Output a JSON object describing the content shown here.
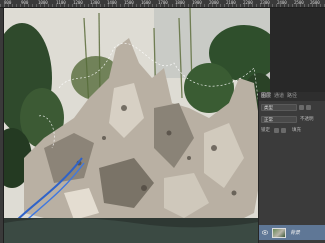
{
  "ruler": {
    "labels": [
      "800",
      "900",
      "1000",
      "1100",
      "1200",
      "1300",
      "1400",
      "1500",
      "1600",
      "1700",
      "1800",
      "1900",
      "2000",
      "2100",
      "2200",
      "2300",
      "2400",
      "2500",
      "2600"
    ]
  },
  "layers_panel": {
    "tabs": [
      "图层",
      "通道",
      "路径"
    ],
    "active_tab": 0,
    "filter_label": "类型",
    "blend_mode": "正常",
    "opacity_label": "不透明",
    "lock_label": "锁定",
    "fill_label": "填充",
    "layer": {
      "name": "背景",
      "visible": true
    }
  },
  "colors": {
    "accent_selected_layer": "#5f7796",
    "panel_bg": "#3b3b3b"
  },
  "icons": [
    "eye-icon",
    "layer-thumbnail",
    "filter-icon",
    "lock-icon"
  ]
}
